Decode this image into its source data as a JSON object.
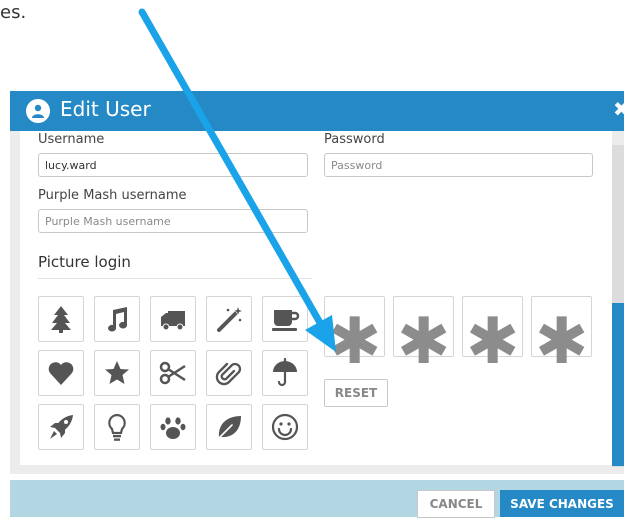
{
  "intro_text": "es.",
  "modal": {
    "title": "Edit User",
    "close_symbol": "✖",
    "header_icon": "user-icon",
    "accent_color": "#2489c5"
  },
  "form": {
    "username_label": "Username",
    "username_value": "lucy.ward",
    "password_label": "Password",
    "password_placeholder": "Password",
    "purple_mash_label": "Purple Mash username",
    "purple_mash_placeholder": "Purple Mash username"
  },
  "picture_login": {
    "title": "Picture login",
    "icons": [
      "tree-icon",
      "music-note-icon",
      "truck-icon",
      "magic-wand-icon",
      "coffee-cup-icon",
      "heart-icon",
      "star-icon",
      "scissors-icon",
      "paperclip-icon",
      "umbrella-icon",
      "rocket-icon",
      "lightbulb-icon",
      "paw-icon",
      "leaf-icon",
      "smiley-icon"
    ],
    "slots": [
      "✱",
      "✱",
      "✱",
      "✱"
    ],
    "reset_label": "RESET"
  },
  "footer": {
    "cancel_label": "CANCEL",
    "save_label": "SAVE CHANGES"
  }
}
